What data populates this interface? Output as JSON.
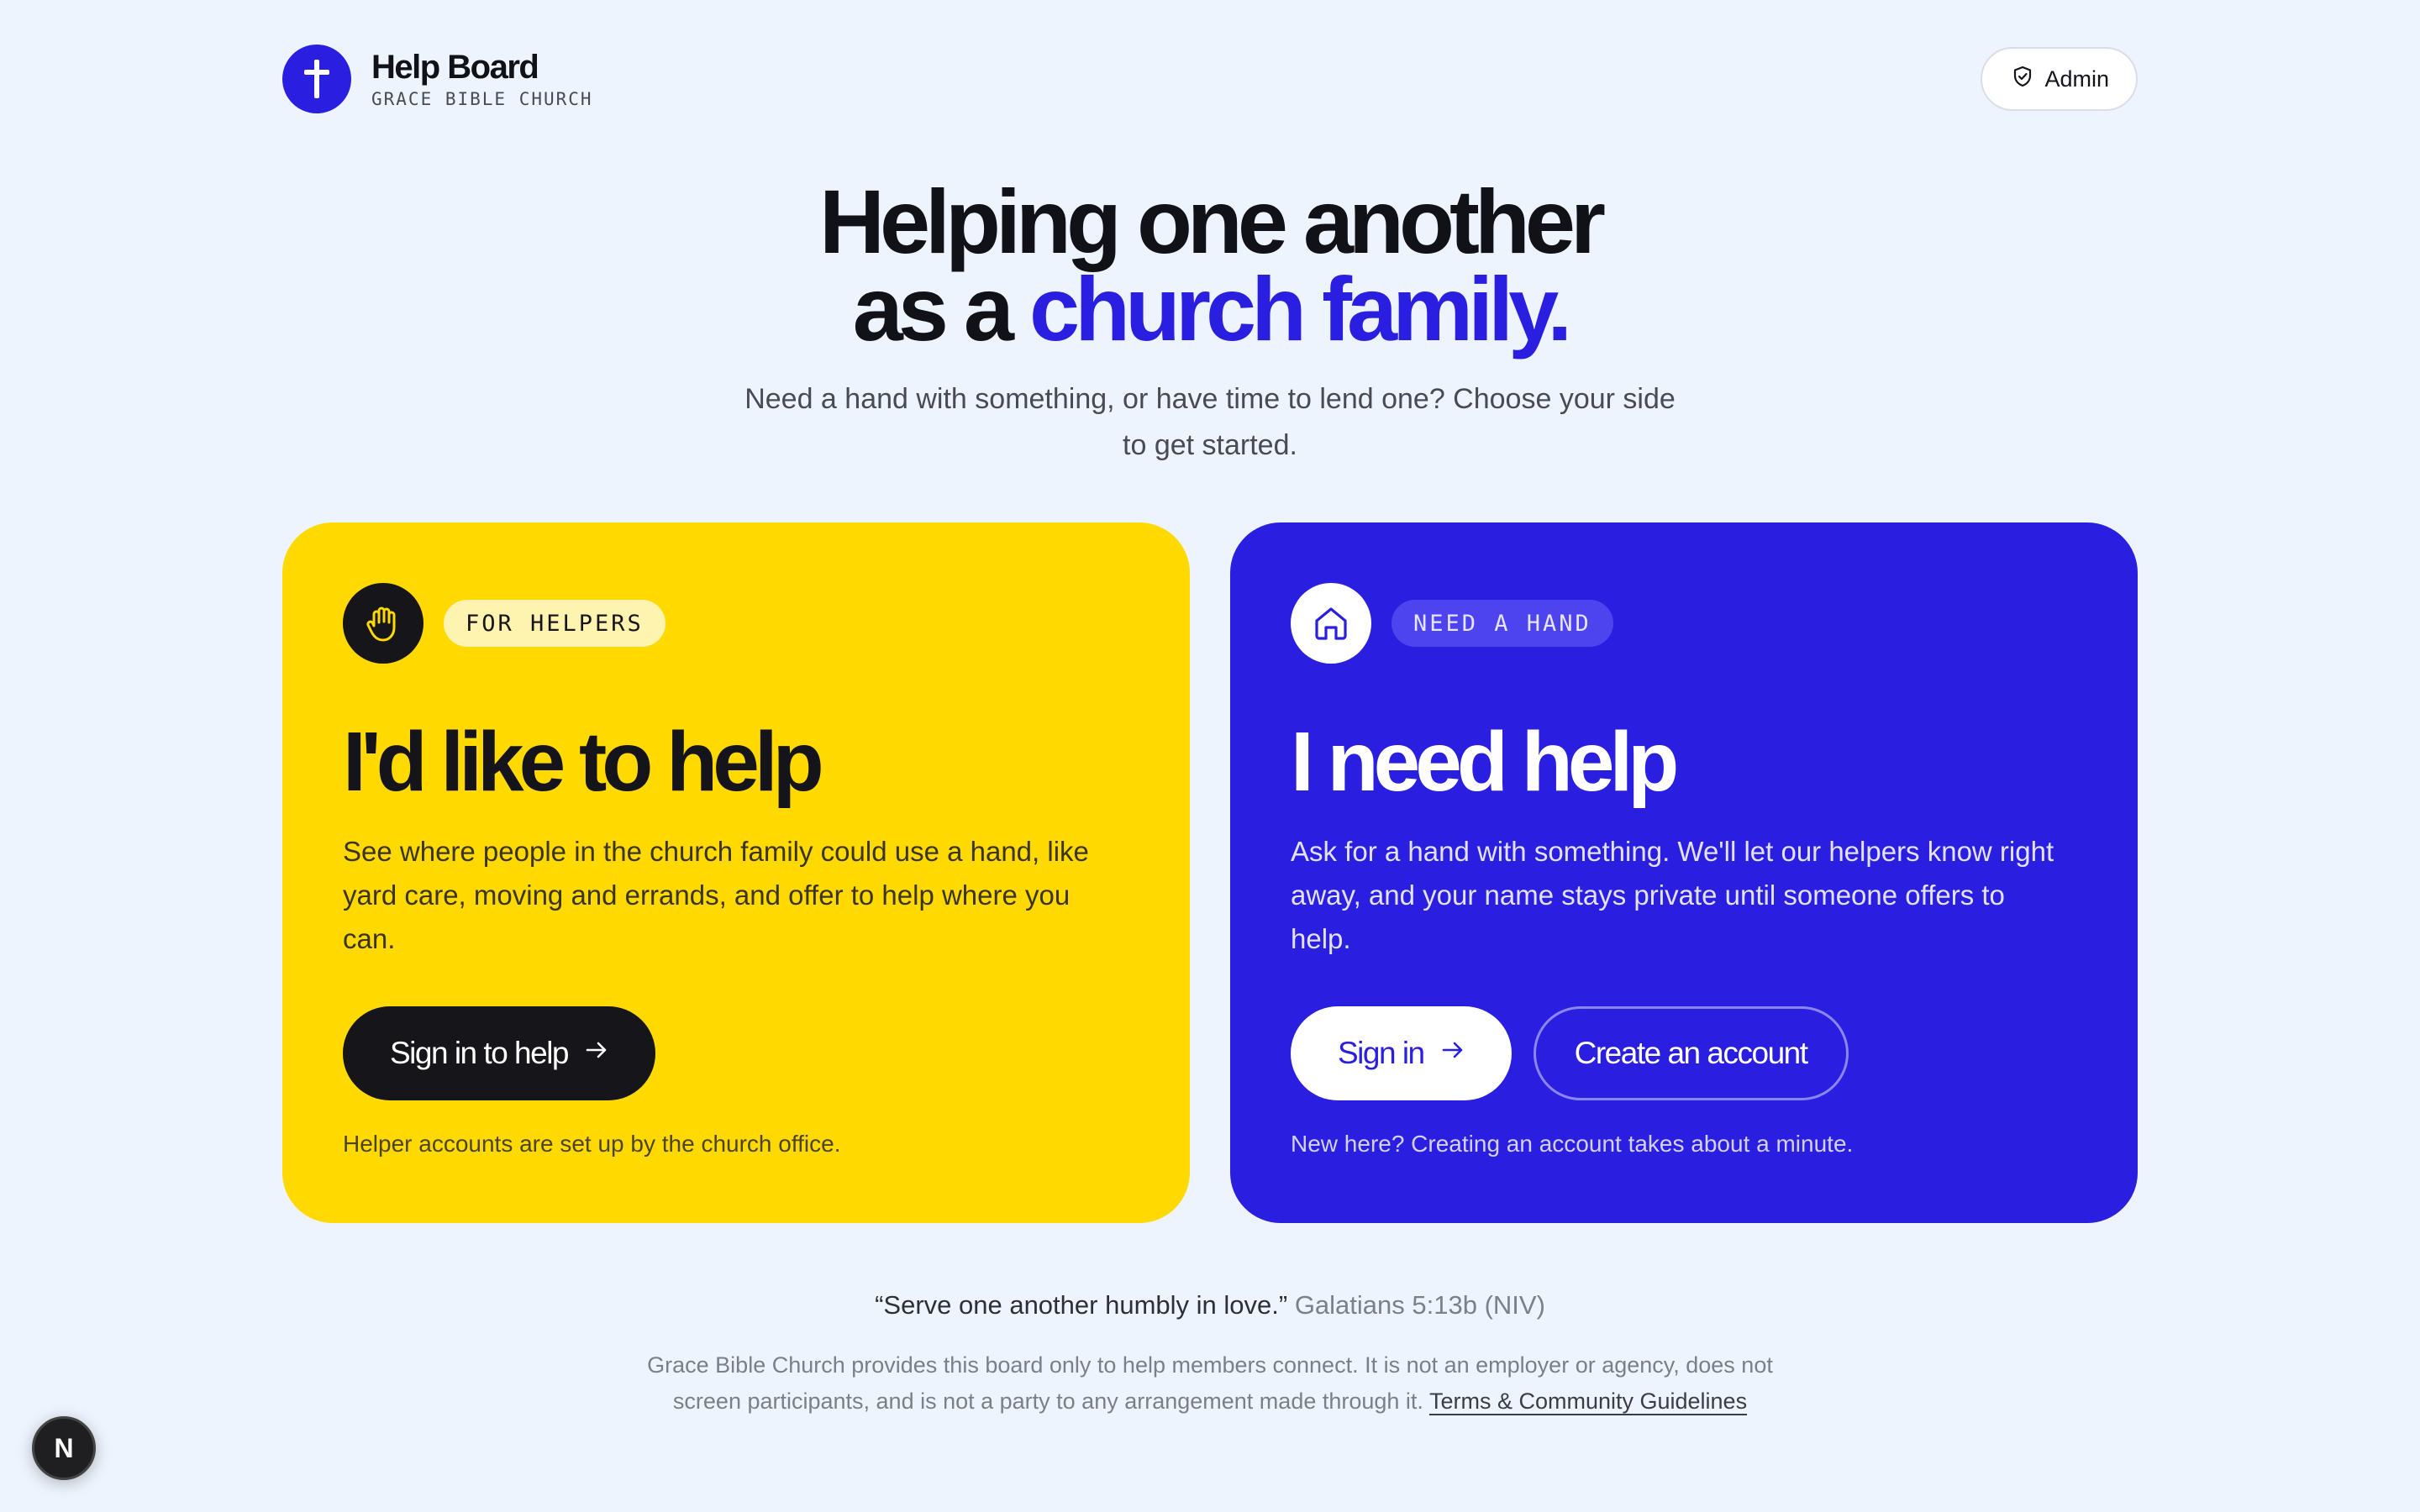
{
  "header": {
    "brand_name": "Help Board",
    "brand_sub": "GRACE BIBLE CHURCH",
    "admin_label": "Admin"
  },
  "hero": {
    "title_line1": "Helping one another",
    "title_line2_prefix": "as a ",
    "title_line2_accent": "church family.",
    "subtitle": "Need a hand with something, or have time to lend one? Choose your side to get started."
  },
  "helpers_card": {
    "pill": "FOR HELPERS",
    "title": "I'd like to help",
    "body": "See where people in the church family could use a hand, like yard care, moving and errands, and offer to help where you can.",
    "button": "Sign in to help",
    "note": "Helper accounts are set up by the church office."
  },
  "need_card": {
    "pill": "NEED A HAND",
    "title": "I need help",
    "body": "Ask for a hand with something. We'll let our helpers know right away, and your name stays private until someone offers to help.",
    "sign_in": "Sign in",
    "create": "Create an account",
    "note": "New here? Creating an account takes about a minute."
  },
  "footer": {
    "quote": "“Serve one another humbly in love.”",
    "quote_ref": "Galatians 5:13b (NIV)",
    "disclaimer": "Grace Bible Church provides this board only to help members connect. It is not an employer or agency, does not screen participants, and is not a party to any arrangement made through it.",
    "terms_link": "Terms & Community Guidelines"
  },
  "badge": {
    "letter": "N"
  },
  "colors": {
    "accent_blue": "#2a1fe0",
    "accent_yellow": "#ffd900",
    "background": "#eef4fd"
  }
}
